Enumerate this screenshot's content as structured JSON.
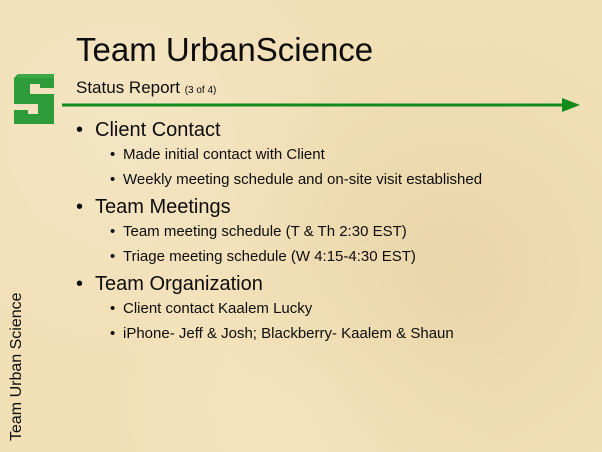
{
  "slide": {
    "title": "Team UrbanScience",
    "subtitle": "Status Report",
    "page_indicator": "(3 of 4)",
    "side_label": "Team Urban Science",
    "logo_icon": "msu-spartan-s-logo-icon",
    "arrow_color": "#138a1c",
    "logo_color": "#2e9c3a",
    "sections": [
      {
        "heading": "Client Contact",
        "items": [
          "Made initial contact with Client",
          "Weekly meeting schedule and on-site visit established"
        ]
      },
      {
        "heading": "Team Meetings",
        "items": [
          "Team meeting schedule (T & Th 2:30 EST)",
          "Triage meeting schedule (W 4:15-4:30 EST)"
        ]
      },
      {
        "heading": "Team Organization",
        "items": [
          "Client contact Kaalem Lucky",
          "iPhone- Jeff & Josh; Blackberry- Kaalem & Shaun"
        ]
      }
    ]
  }
}
